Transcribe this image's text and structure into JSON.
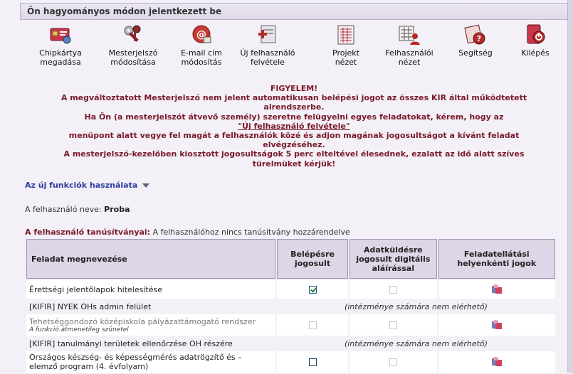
{
  "header": {
    "title": "Ön hagyományos módon jelentkezett be"
  },
  "toolbar": {
    "items": [
      {
        "label_1": "Chipkártya",
        "label_2": "megadása",
        "icon": "chip-card-icon"
      },
      {
        "label_1": "Mesterjelszó",
        "label_2": "módosítása",
        "icon": "keys-icon"
      },
      {
        "label_1": "E-mail cím",
        "label_2": "módosítás",
        "icon": "email-icon"
      },
      {
        "label_1": "Új felhasználó",
        "label_2": "felvétele",
        "icon": "add-user-icon"
      },
      {
        "label_1": "Projekt",
        "label_2": "nézet",
        "icon": "project-grid-icon"
      },
      {
        "label_1": "Felhasználói",
        "label_2": "nézet",
        "icon": "user-view-icon"
      },
      {
        "label_1": "Segítség",
        "label_2": "",
        "icon": "help-icon"
      },
      {
        "label_1": "Kilépés",
        "label_2": "",
        "icon": "exit-icon"
      }
    ]
  },
  "warning": {
    "line1": "FIGYELEM!",
    "line2": "A megváltoztatott Mesterjelszó nem jelent automatikusan belépési jogot az összes KIR által működtetett",
    "line3": "alrendszerbe.",
    "line4": "Ha Ön (a mesterjelszót átvevő személy) szeretne felügyelni egyes feladatokat, kérem, hogy az",
    "link": "\"Új felhasználó felvétele\"",
    "line5": "menüpont alatt vegye fel magát a felhasználók közé és adjon magának jogosultságot a kívánt feladat",
    "line6": "elvégzéséhez.",
    "line7": "A mesterjelszó-kezelőben kiosztott jogosultságok 5 perc elteltével élesednek, ezalatt az idő alatt szíves",
    "line8": "türelmüket kérjük!"
  },
  "functions_link": "Az új funkciók használata",
  "user": {
    "label": "A felhasználó neve:",
    "name": "Proba"
  },
  "certificates": {
    "label": "A felhasználó tanúsítványai:",
    "text": "A felhasználóhoz nincs tanúsítvány hozzárendelve"
  },
  "table": {
    "headers": {
      "task": "Feladat megnevezése",
      "login": "Belépésre jogosult",
      "sign": "Adatküldésre jogosult digitális aláírással",
      "rights": "Feladatellátási helyenkénti jogok"
    },
    "rows": [
      {
        "name": "Érettségi jelentőlapok hitelesítése",
        "sub": "",
        "login": "checked",
        "sign": "dim",
        "rights": true
      },
      {
        "name": "[KIFIR] NYEK OHs admin felület",
        "sub": "",
        "na": "(intézménye számára nem elérhető)"
      },
      {
        "name": "Tehetséggondozó középiskola pályázattámogató rendszer",
        "sub": "A funkció átmenetileg szünetel",
        "login": "dim",
        "sign": "dim",
        "rights": true,
        "grey": true
      },
      {
        "name": "[KIFIR] tanulmányi területek ellenőrzése OH részére",
        "sub": "",
        "na": "(intézménye számára nem elérhető)"
      },
      {
        "name": "Országos készség- és képességmérés adatrögzítő és –",
        "name2": "elemző program (4. évfolyam)",
        "sub": "",
        "login": "blue",
        "sign": "dim",
        "rights": true
      }
    ]
  }
}
